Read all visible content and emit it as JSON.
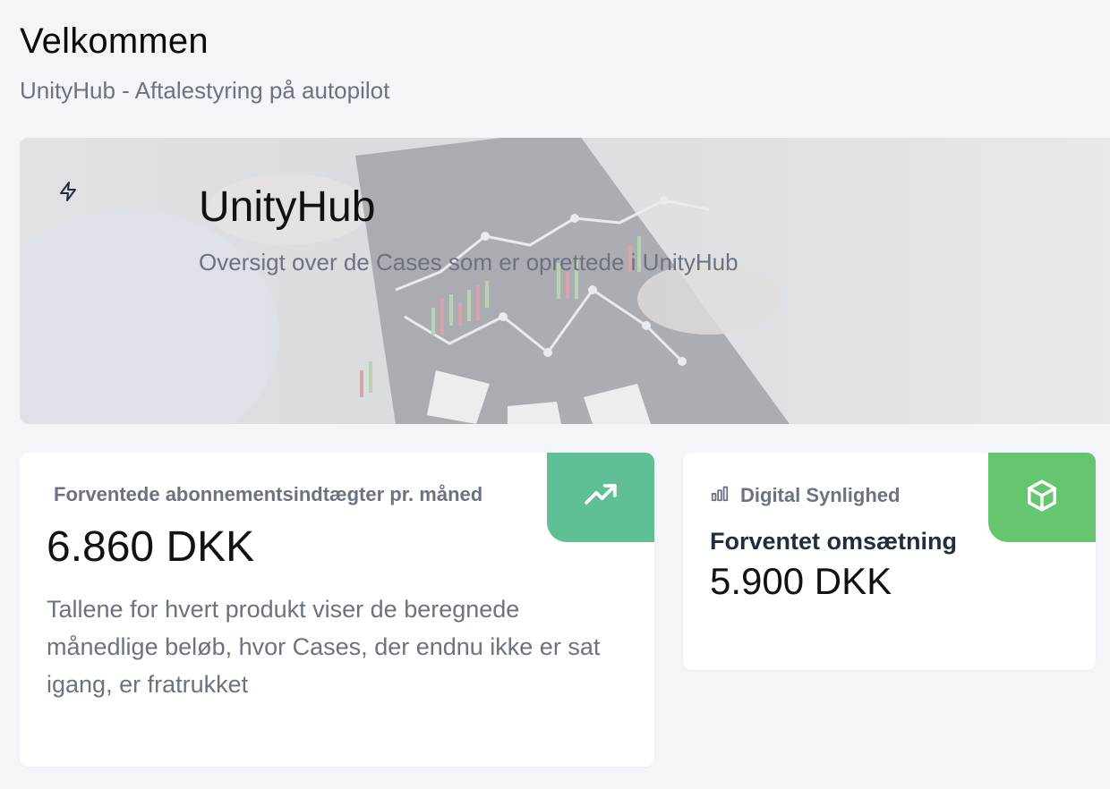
{
  "header": {
    "title": "Velkommen",
    "subtitle": "UnityHub - Aftalestyring på autopilot"
  },
  "hero": {
    "icon": "lightning-icon",
    "title": "UnityHub",
    "description": "Oversigt over de Cases som er oprettede i UnityHub"
  },
  "cards": {
    "subscription": {
      "label": "Forventede abonnementsindtægter pr. måned",
      "value": "6.860 DKK",
      "description": "Tallene for hvert produkt viser de beregnede månedlige beløb, hvor Cases, der endnu ikke er sat igang, er fratrukket",
      "icon": "trending-up-icon",
      "accent": "#5fbf97"
    },
    "digital": {
      "label_icon": "bar-chart-icon",
      "label": "Digital Synlighed",
      "sublabel": "Forventet omsætning",
      "value": "5.900 DKK",
      "icon": "box-icon",
      "accent": "#66c56f"
    }
  }
}
